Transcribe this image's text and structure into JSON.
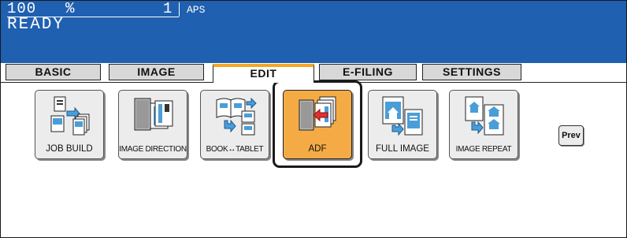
{
  "display": {
    "zoom_value": "100",
    "zoom_unit": "%",
    "copies": "1",
    "paper_mode": "APS",
    "status": "READY"
  },
  "tabs": [
    {
      "label": "BASIC",
      "active": false
    },
    {
      "label": "IMAGE",
      "active": false
    },
    {
      "label": "EDIT",
      "active": true
    },
    {
      "label": "E-FILING",
      "active": false
    },
    {
      "label": "SETTINGS",
      "active": false
    }
  ],
  "functions": [
    {
      "label": "JOB BUILD",
      "icon": "job-build-icon"
    },
    {
      "label": "IMAGE DIRECTION",
      "icon": "image-direction-icon"
    },
    {
      "label": "BOOK↔TABLET",
      "icon": "book-tablet-icon"
    },
    {
      "label": "ADF",
      "icon": "adf-icon",
      "selected": true
    },
    {
      "label": "FULL IMAGE",
      "icon": "full-image-icon"
    },
    {
      "label": "IMAGE REPEAT",
      "icon": "image-repeat-icon"
    }
  ],
  "nav": {
    "prev_label": "Prev"
  },
  "colors": {
    "header": "#1f60b0",
    "accent": "#f5a623",
    "selected": "#f5ab45"
  }
}
